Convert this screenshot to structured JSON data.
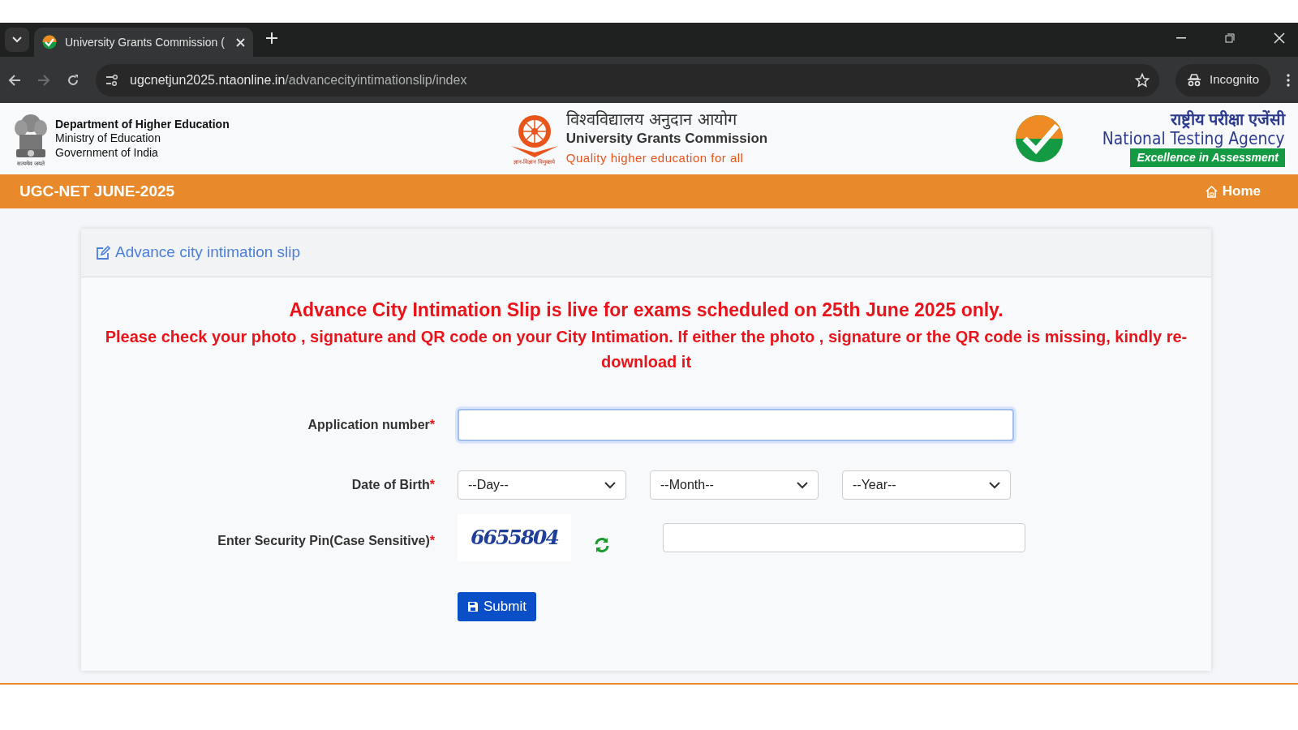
{
  "browser": {
    "tabs": [
      {
        "title": "University Grants Commission (",
        "selected": true
      }
    ],
    "url_host": "ugcnetjun2025.ntaonline.in",
    "url_path": "/advancecityintimationslip/index",
    "profile": "Incognito"
  },
  "header": {
    "left": {
      "motto": "सत्यमेव जयते",
      "lines": [
        "Department of Higher Education",
        "Ministry of Education",
        "Government of India"
      ]
    },
    "center": {
      "logo_motto": "ज्ञान-विज्ञान विमुक्तये",
      "hindi": "विश्वविद्यालय अनुदान आयोग",
      "name": "University Grants Commission",
      "tagline": "Quality higher education for all"
    },
    "right": {
      "hindi": "राष्ट्रीय परीक्षा एजेंसी",
      "name": "National Testing Agency",
      "tagline": "Excellence in Assessment"
    }
  },
  "navbar": {
    "title": "UGC-NET JUNE-2025",
    "links": [
      "Home"
    ]
  },
  "card": {
    "title": "Advance city intimation slip",
    "notices": [
      "Advance City Intimation Slip is live for exams scheduled on 25th June 2025 only.",
      "Please check your photo , signature and QR code on your City Intimation. If either the photo , signature or the QR code is missing, kindly re-download it"
    ],
    "form": {
      "application": {
        "label": "Application number",
        "asterisk": "*",
        "focused": true
      },
      "dob": {
        "label": "Date of Birth",
        "asterisk": "*",
        "selects": [
          "--Day--",
          "--Month--",
          "--Year--"
        ]
      },
      "pin": {
        "label": "Enter Security Pin(Case Sensitive)",
        "asterisk": "*",
        "captcha": "6655804"
      },
      "submit": "Submit"
    }
  }
}
